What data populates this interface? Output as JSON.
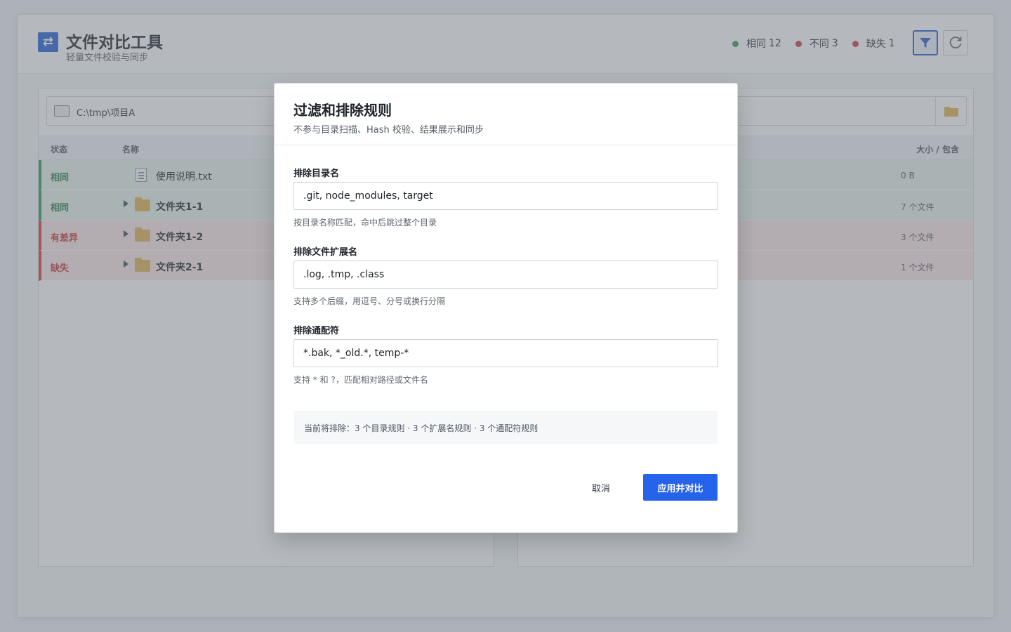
{
  "colors": {
    "accent": "#2563eb",
    "same": "#2f9a4f",
    "diff": "#d03b3b",
    "missing": "#d03b3b"
  },
  "header": {
    "title": "文件对比工具",
    "subtitle": "轻量文件校验与同步",
    "logo_icon": "swap-arrows-icon",
    "stats": {
      "same_label": "相同",
      "same_count": "12",
      "diff_label": "不同",
      "diff_count": "3",
      "missing_label": "缺失",
      "missing_count": "1"
    },
    "filter_icon": "filter-icon",
    "refresh_icon": "refresh-icon"
  },
  "left_panel": {
    "path": "C:\\tmp\\项目A",
    "columns": {
      "status": "状态",
      "name": "名称",
      "size": "大小 / 包含"
    },
    "rows": [
      {
        "status": "相同",
        "name": "使用说明.txt",
        "size": "0 B"
      },
      {
        "status": "相同",
        "name": "文件夹1-1",
        "size": "7 个文件"
      },
      {
        "status": "有差异",
        "name": "文件夹1-2",
        "size": "3 个文件"
      },
      {
        "status": "缺失",
        "name": "文件夹2-1",
        "size": "1 个文件"
      }
    ]
  },
  "modal": {
    "title": "过滤和排除规则",
    "subtitle": "不参与目录扫描、Hash 校验、结果展示和同步",
    "fields": [
      {
        "label": "排除目录名",
        "value": ".git, node_modules, target",
        "hint": "按目录名称匹配，命中后跳过整个目录"
      },
      {
        "label": "排除文件扩展名",
        "value": ".log, .tmp, .class",
        "hint": "支持多个后缀，用逗号、分号或换行分隔"
      },
      {
        "label": "排除通配符",
        "value": "*.bak, *_old.*, temp-*",
        "hint": "支持 * 和 ?，匹配相对路径或文件名"
      }
    ],
    "summary": "当前将排除：3 个目录规则 · 3 个扩展名规则 · 3 个通配符规则",
    "cancel_label": "取消",
    "apply_label": "应用并对比"
  }
}
